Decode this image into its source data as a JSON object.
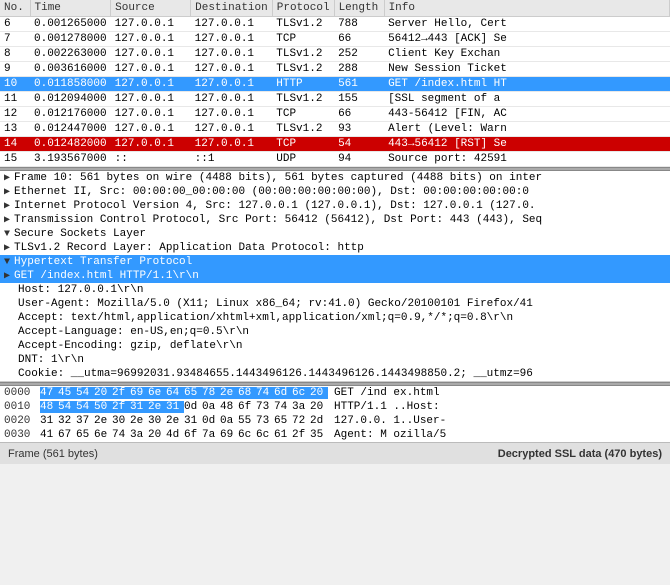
{
  "header": {
    "columns": [
      "No.",
      "Time",
      "Source",
      "Destination",
      "Protocol",
      "Length",
      "Info"
    ]
  },
  "packets": [
    {
      "no": "6",
      "time": "0.001265000",
      "src": "127.0.0.1",
      "dst": "127.0.0.1",
      "proto": "TLSv1.2",
      "len": "788",
      "info": "Server Hello, Cert",
      "style": "row-normal"
    },
    {
      "no": "7",
      "time": "0.001278000",
      "src": "127.0.0.1",
      "dst": "127.0.0.1",
      "proto": "TCP",
      "len": "66",
      "info": "56412→443 [ACK] Se",
      "style": "row-normal"
    },
    {
      "no": "8",
      "time": "0.002263000",
      "src": "127.0.0.1",
      "dst": "127.0.0.1",
      "proto": "TLSv1.2",
      "len": "252",
      "info": "Client Key Exchan",
      "style": "row-normal"
    },
    {
      "no": "9",
      "time": "0.003616000",
      "src": "127.0.0.1",
      "dst": "127.0.0.1",
      "proto": "TLSv1.2",
      "len": "288",
      "info": "New Session Ticket",
      "style": "row-normal"
    },
    {
      "no": "10",
      "time": "0.011858000",
      "src": "127.0.0.1",
      "dst": "127.0.0.1",
      "proto": "HTTP",
      "len": "561",
      "info": "GET /index.html HT",
      "style": "row-selected-http"
    },
    {
      "no": "11",
      "time": "0.012094000",
      "src": "127.0.0.1",
      "dst": "127.0.0.1",
      "proto": "TLSv1.2",
      "len": "155",
      "info": "[SSL segment of a",
      "style": "row-normal"
    },
    {
      "no": "12",
      "time": "0.012176000",
      "src": "127.0.0.1",
      "dst": "127.0.0.1",
      "proto": "TCP",
      "len": "66",
      "info": "443-56412 [FIN, AC",
      "style": "row-normal"
    },
    {
      "no": "13",
      "time": "0.012447000",
      "src": "127.0.0.1",
      "dst": "127.0.0.1",
      "proto": "TLSv1.2",
      "len": "93",
      "info": "Alert (Level: Warn",
      "style": "row-normal"
    },
    {
      "no": "14",
      "time": "0.012482000",
      "src": "127.0.0.1",
      "dst": "127.0.0.1",
      "proto": "TCP",
      "len": "54",
      "info": "443→56412 [RST] Se",
      "style": "row-selected-tcp"
    },
    {
      "no": "15",
      "time": "3.193567000",
      "src": "::",
      "dst": "::1",
      "proto": "UDP",
      "len": "94",
      "info": "Source port: 42591",
      "style": "row-normal"
    }
  ],
  "details": [
    {
      "indent": 0,
      "arrow": "▶",
      "text": "Frame 10: 561 bytes on wire (4488 bits), 561 bytes captured (4488 bits) on inter",
      "expandable": true,
      "highlighted": false
    },
    {
      "indent": 0,
      "arrow": "▶",
      "text": "Ethernet II, Src: 00:00:00_00:00:00 (00:00:00:00:00:00), Dst: 00:00:00:00:00:0",
      "expandable": true,
      "highlighted": false
    },
    {
      "indent": 0,
      "arrow": "▶",
      "text": "Internet Protocol Version 4, Src: 127.0.0.1 (127.0.0.1), Dst: 127.0.0.1 (127.0.",
      "expandable": true,
      "highlighted": false
    },
    {
      "indent": 0,
      "arrow": "▶",
      "text": "Transmission Control Protocol, Src Port: 56412 (56412), Dst Port: 443 (443), Seq",
      "expandable": true,
      "highlighted": false
    },
    {
      "indent": 0,
      "arrow": "▼",
      "text": "Secure Sockets Layer",
      "expandable": true,
      "highlighted": false
    },
    {
      "indent": 1,
      "arrow": "▶",
      "text": "TLSv1.2 Record Layer: Application Data Protocol: http",
      "expandable": true,
      "highlighted": false
    },
    {
      "indent": 0,
      "arrow": "▼",
      "text": "Hypertext Transfer Protocol",
      "expandable": true,
      "highlighted": true
    },
    {
      "indent": 1,
      "arrow": "▶",
      "text": "GET /index.html HTTP/1.1\\r\\n",
      "expandable": true,
      "highlighted": true
    },
    {
      "indent": 2,
      "arrow": "",
      "text": "Host: 127.0.0.1\\r\\n",
      "expandable": false,
      "highlighted": false
    },
    {
      "indent": 2,
      "arrow": "",
      "text": "User-Agent: Mozilla/5.0 (X11; Linux x86_64; rv:41.0) Gecko/20100101 Firefox/41",
      "expandable": false,
      "highlighted": false
    },
    {
      "indent": 2,
      "arrow": "",
      "text": "Accept: text/html,application/xhtml+xml,application/xml;q=0.9,*/*;q=0.8\\r\\n",
      "expandable": false,
      "highlighted": false
    },
    {
      "indent": 2,
      "arrow": "",
      "text": "Accept-Language: en-US,en;q=0.5\\r\\n",
      "expandable": false,
      "highlighted": false
    },
    {
      "indent": 2,
      "arrow": "",
      "text": "Accept-Encoding: gzip, deflate\\r\\n",
      "expandable": false,
      "highlighted": false
    },
    {
      "indent": 2,
      "arrow": "",
      "text": "DNT: 1\\r\\n",
      "expandable": false,
      "highlighted": false
    },
    {
      "indent": 2,
      "arrow": "",
      "text": "Cookie: __utma=96992031.93484655.1443496126.1443496126.1443498850.2; __utmz=96",
      "expandable": false,
      "highlighted": false
    }
  ],
  "hex_rows": [
    {
      "offset": "0000",
      "bytes": [
        "47",
        "45",
        "54",
        "20",
        "2f",
        "69",
        "6e",
        "64",
        "65",
        "78",
        "2e",
        "68",
        "74",
        "6d",
        "6c",
        "20"
      ],
      "ascii": "GET /ind ex.html ",
      "hl_start": 0,
      "hl_end": 16
    },
    {
      "offset": "0010",
      "bytes": [
        "48",
        "54",
        "54",
        "50",
        "2f",
        "31",
        "2e",
        "31",
        "0d",
        "0a",
        "48",
        "6f",
        "73",
        "74",
        "3a",
        "20"
      ],
      "ascii": "HTTP/1.1 ..Host:  ",
      "hl_start": 0,
      "hl_end": 8
    },
    {
      "offset": "0020",
      "bytes": [
        "31",
        "32",
        "37",
        "2e",
        "30",
        "2e",
        "30",
        "2e",
        "31",
        "0d",
        "0a",
        "55",
        "73",
        "65",
        "72",
        "2d"
      ],
      "ascii": "127.0.0. 1..User-",
      "hl_start": -1,
      "hl_end": -1
    },
    {
      "offset": "0030",
      "bytes": [
        "41",
        "67",
        "65",
        "6e",
        "74",
        "3a",
        "20",
        "4d",
        "6f",
        "7a",
        "69",
        "6c",
        "6c",
        "61",
        "2f",
        "35"
      ],
      "ascii": "Agent: M ozilla/5",
      "hl_start": -1,
      "hl_end": -1
    }
  ],
  "status": {
    "left": "Frame (561 bytes)",
    "right": "Decrypted SSL data (470 bytes)"
  }
}
